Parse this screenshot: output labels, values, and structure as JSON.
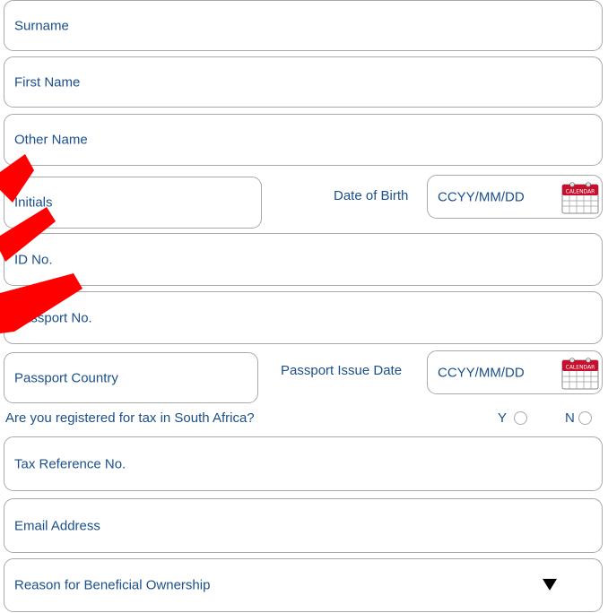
{
  "form": {
    "surname_label": "Surname",
    "first_name_label": "First Name",
    "other_name_label": "Other Name",
    "initials_label": "Initials",
    "dob_label": "Date of Birth",
    "dob_placeholder": "CCYY/MM/DD",
    "id_no_label": "ID No.",
    "passport_no_label": "Passport No.",
    "passport_country_label": "Passport Country",
    "passport_issue_date_label": "Passport Issue Date",
    "passport_issue_placeholder": "CCYY/MM/DD",
    "tax_question": "Are you registered for tax in South Africa?",
    "radio_yes": "Y",
    "radio_no": "N",
    "tax_ref_label": "Tax Reference No.",
    "email_label": "Email Address",
    "reason_label": "Reason for Beneficial Ownership"
  },
  "icons": {
    "calendar": "calendar-icon",
    "calendar_text": "CALENDAR",
    "dropdown": "chevron-down-icon"
  },
  "colors": {
    "label_text": "#1a4f8b",
    "border": "#a9a9a9",
    "calendar_red": "#c8102e",
    "redaction": "#ff0000"
  }
}
